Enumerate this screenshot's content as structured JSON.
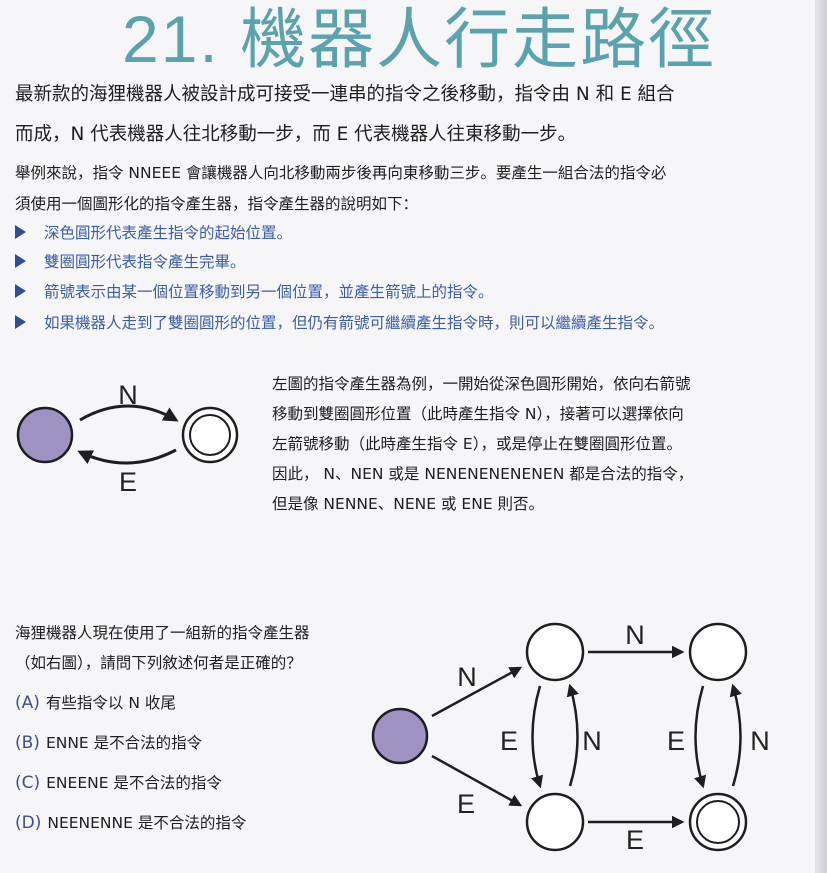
{
  "title": "21. 機器人行走路徑",
  "intro": [
    "最新款的海狸機器人被設計成可接受一連串的指令之後移動，指令由 N 和 E 組合",
    "而成，N 代表機器人往北移動一步，而 E 代表機器人往東移動一步。"
  ],
  "example": [
    "舉例來說，指令 NNEEE 會讓機器人向北移動兩步後再向東移動三步。要產生一組合法的指令必",
    "須使用一個圖形化的指令產生器，指令產生器的說明如下："
  ],
  "bullets": [
    "深色圓形代表產生指令的起始位置。",
    "雙圈圓形代表指令產生完畢。",
    "箭號表示由某一個位置移動到另一個位置，並產生箭號上的指令。",
    "如果機器人走到了雙圈圓形的位置，但仍有箭號可繼續產生指令時，則可以繼續產生指令。"
  ],
  "small_diagram": {
    "top_label": "N",
    "bottom_label": "E",
    "start_color": "#9d92c2"
  },
  "explanation": [
    "左圖的指令產生器為例，一開始從深色圓形開始，依向右箭號",
    "移動到雙圈圓形位置（此時產生指令 N），接著可以選擇依向",
    "左箭號移動（此時產生指令 E），或是停止在雙圈圓形位置。",
    "因此， N、NEN 或是 NENENENENENEN 都是合法的指令，",
    "但是像 NENNE、NENE 或 ENE 則否。"
  ],
  "question": [
    "海狸機器人現在使用了一組新的指令產生器",
    "（如右圖），請問下列敘述何者是正確的？"
  ],
  "options": [
    {
      "label": "(A)",
      "text": "有些指令以 N 收尾"
    },
    {
      "label": "(B)",
      "text": "ENNE 是不合法的指令"
    },
    {
      "label": "(C)",
      "text": "ENEENE 是不合法的指令"
    },
    {
      "label": "(D)",
      "text": "NEENENNE 是不合法的指令"
    }
  ],
  "big_diagram": {
    "start_to_top": "N",
    "start_to_bottom": "E",
    "top_mid_to_top_right": "N",
    "bottom_mid_to_bottom_right": "E",
    "left_down": "E",
    "left_up": "N",
    "right_down": "E",
    "right_up": "N"
  },
  "colors": {
    "title": "#5aa3ad",
    "bullet_text": "#3c5ea8",
    "start_node": "#9d92c2"
  }
}
